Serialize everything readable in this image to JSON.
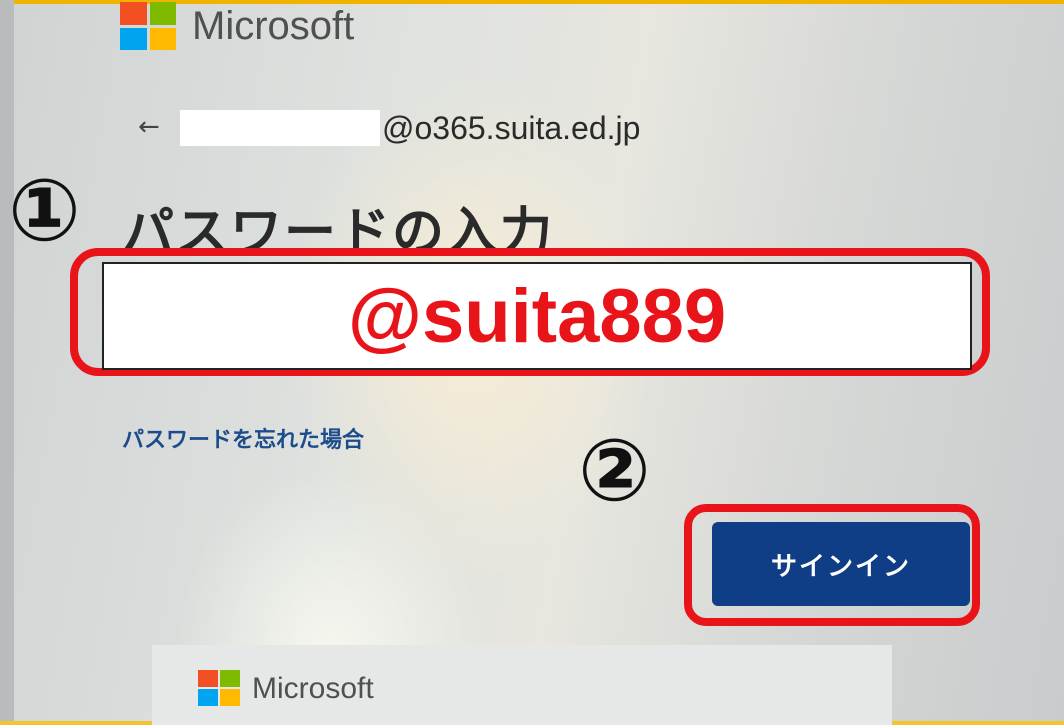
{
  "brand": {
    "name": "Microsoft"
  },
  "account": {
    "back_icon": "arrow-left-icon",
    "email_domain": "@o365.suita.ed.jp"
  },
  "steps": {
    "one": "①",
    "two": "②"
  },
  "page": {
    "heading": "パスワードの入力"
  },
  "password": {
    "value": "@suita889"
  },
  "links": {
    "forgot": "パスワードを忘れた場合"
  },
  "buttons": {
    "signin": "サインイン"
  },
  "bottom": {
    "brand": "Microsoft"
  },
  "colors": {
    "highlight": "#e8141a",
    "button": "#0f3d86",
    "link": "#1d4c8c",
    "top_border": "#f0b400"
  }
}
